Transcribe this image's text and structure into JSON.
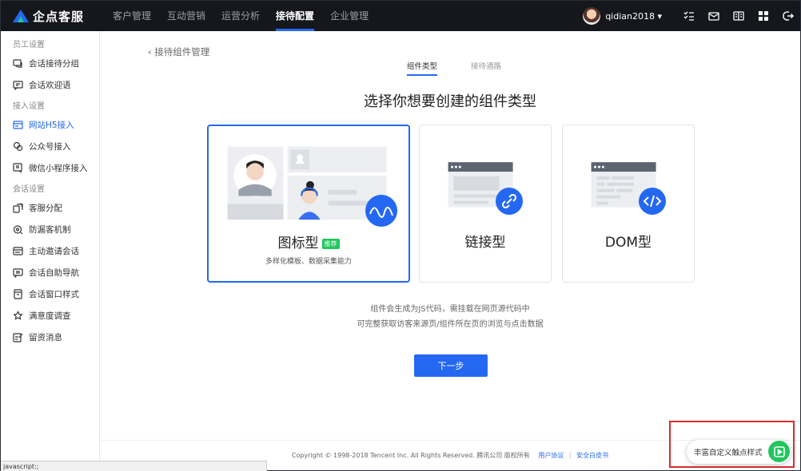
{
  "app": {
    "logo_text": "企点客服"
  },
  "nav": {
    "items": [
      {
        "label": "客户管理"
      },
      {
        "label": "互动营销"
      },
      {
        "label": "运营分析"
      },
      {
        "label": "接待配置"
      },
      {
        "label": "企业管理"
      }
    ],
    "active_index": 3
  },
  "user": {
    "name": "qidian2018 ▾"
  },
  "sidebar": {
    "group1": "员工设置",
    "group1_items": [
      {
        "label": "会话接待分组"
      },
      {
        "label": "会话欢迎语"
      }
    ],
    "group2": "接入设置",
    "group2_items": [
      {
        "label": "网站H5接入"
      },
      {
        "label": "公众号接入"
      },
      {
        "label": "微信小程序接入"
      }
    ],
    "group3": "会话设置",
    "group3_items": [
      {
        "label": "客服分配"
      },
      {
        "label": "防漏客机制"
      },
      {
        "label": "主动邀请会话"
      },
      {
        "label": "会话自助导航"
      },
      {
        "label": "会话窗口样式"
      },
      {
        "label": "满意度调查"
      },
      {
        "label": "留资消息"
      }
    ]
  },
  "main": {
    "back_label": "接待组件管理",
    "steps": [
      {
        "label": "组件类型"
      },
      {
        "label": "接待通路"
      }
    ],
    "heading": "选择你想要创建的组件类型",
    "cards": [
      {
        "title": "图标型",
        "badge": "推荐",
        "desc": "多样化模板、数据采集能力"
      },
      {
        "title": "链接型"
      },
      {
        "title": "DOM型"
      }
    ],
    "info_line1": "组件会生成为JS代码，需挂载在网页源代码中",
    "info_line2": "可完整获取访客来源页/组件所在页的浏览与点击数据",
    "next_button": "下一步"
  },
  "footer": {
    "copyright": "Copyright © 1998-2018 Tencent Inc. All Rights Reserved. 腾讯公司 版权所有",
    "link1": "用户协议",
    "link2": "安全白皮书"
  },
  "status_bar": "javascript:;",
  "float_widget": {
    "label": "丰富自定义触点样式"
  },
  "colors": {
    "primary": "#2468f2",
    "topbar": "#15171c",
    "success": "#22c55e",
    "highlight": "#d92c2c"
  }
}
